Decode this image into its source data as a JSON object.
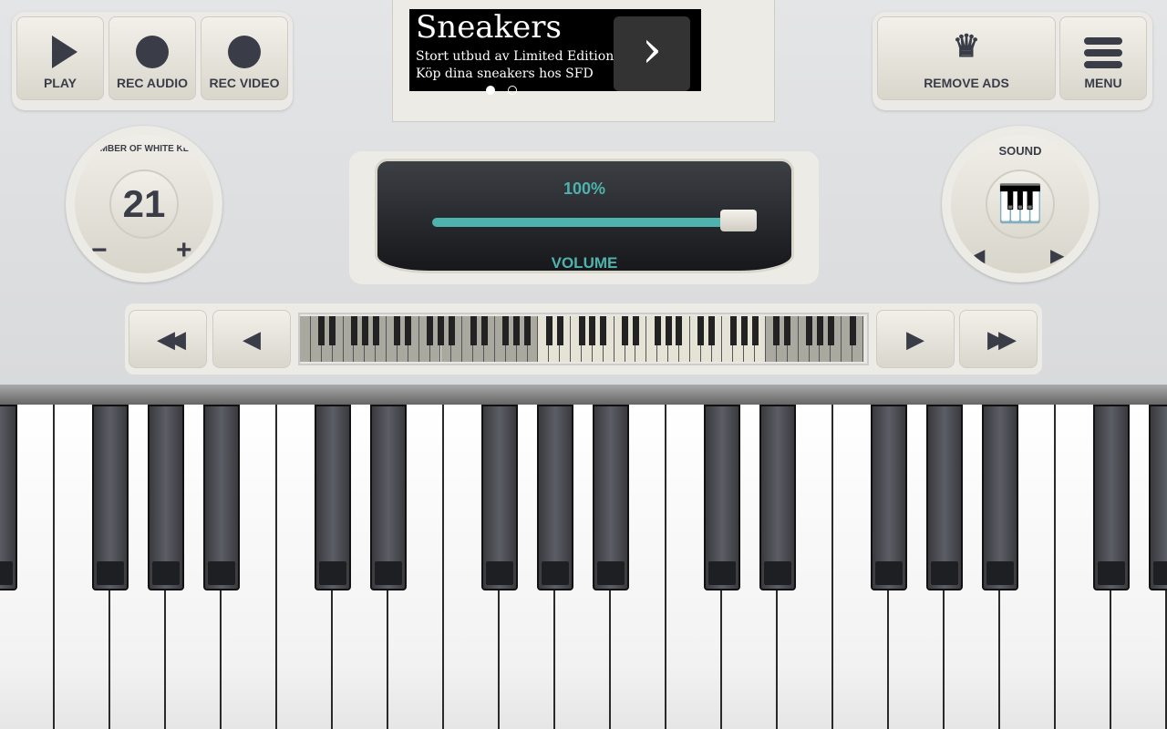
{
  "toolbar": {
    "play": "PLAY",
    "rec_audio": "REC AUDIO",
    "rec_video": "REC VIDEO",
    "remove_ads": "REMOVE ADS",
    "menu": "MENU"
  },
  "ad": {
    "title": "Sneakers",
    "line1": "Stort utbud av Limited Edition.",
    "line2": "Köp dina sneakers hos SFD",
    "arrow": "›"
  },
  "white_keys": {
    "label": "NUMBER OF WHITE KEYS",
    "value": "21",
    "minus": "−",
    "plus": "+"
  },
  "volume": {
    "percent": "100%",
    "label": "VOLUME",
    "level": 1.0,
    "accent": "#4fb3ad"
  },
  "sound": {
    "label": "SOUND",
    "icon": "grand-piano-icon",
    "prev": "◀",
    "next": "▶"
  },
  "navigator": {
    "fast_back": "◀◀",
    "back": "◀",
    "forward": "▶",
    "fast_forward": "▶▶",
    "mini_white_keys": 52,
    "visible_start": 22,
    "visible_count": 21
  }
}
